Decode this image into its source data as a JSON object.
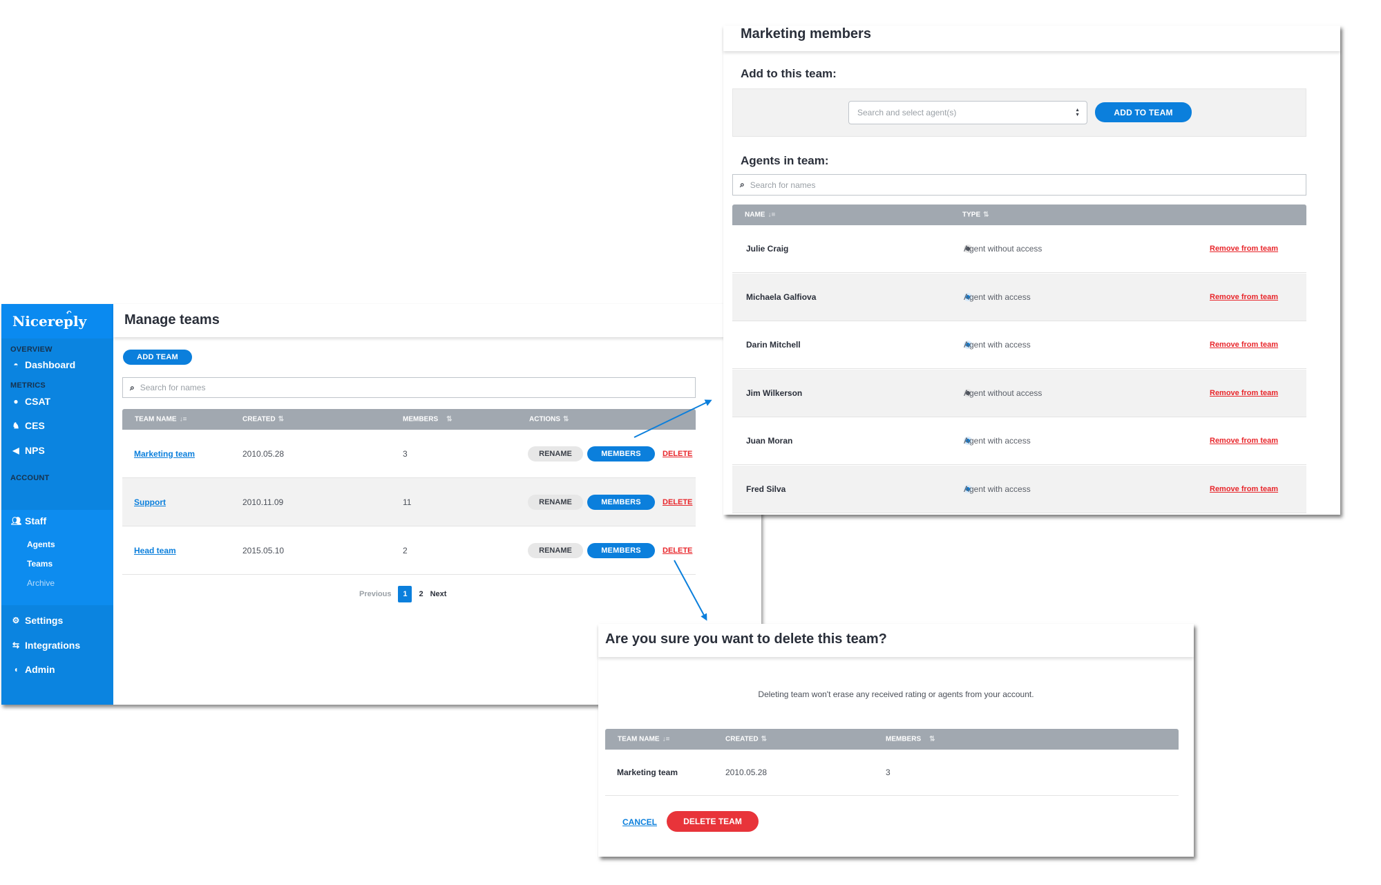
{
  "sidebar": {
    "logo": "Nicereply",
    "sections": {
      "overview": "OVERVIEW",
      "metrics": "METRICS",
      "account": "ACCOUNT"
    },
    "items": {
      "dashboard": {
        "label": "Dashboard",
        "icon": "gauge-icon"
      },
      "csat": {
        "label": "CSAT",
        "icon": "speech-bubble-icon"
      },
      "ces": {
        "label": "CES",
        "icon": "effort-icon"
      },
      "nps": {
        "label": "NPS",
        "icon": "megaphone-icon"
      },
      "staff": {
        "label": "Staff",
        "icon": "users-icon"
      },
      "settings": {
        "label": "Settings",
        "icon": "gears-icon"
      },
      "integrations": {
        "label": "Integrations",
        "icon": "arrows-exchange-icon"
      },
      "admin": {
        "label": "Admin",
        "icon": "pacman-icon"
      }
    },
    "staff_sub": {
      "agents": "Agents",
      "teams": "Teams",
      "archive": "Archive"
    }
  },
  "manage": {
    "title": "Manage teams",
    "add_team": "ADD TEAM",
    "search_placeholder": "Search for names",
    "columns": {
      "name": "TEAM NAME",
      "created": "CREATED",
      "members": "MEMBERS",
      "actions": "ACTIONS"
    },
    "rows": [
      {
        "name": "Marketing team",
        "created": "2010.05.28",
        "members": "3"
      },
      {
        "name": "Support",
        "created": "2010.11.09",
        "members": "11"
      },
      {
        "name": "Head team",
        "created": "2015.05.10",
        "members": "2"
      }
    ],
    "actions": {
      "rename": "RENAME",
      "members": "MEMBERS",
      "delete": "DELETE"
    },
    "pagination": {
      "previous": "Previous",
      "current": "1",
      "page2": "2",
      "next": "Next"
    }
  },
  "members": {
    "title": "Marketing members",
    "add_heading": "Add to this team:",
    "select_placeholder": "Search and select agent(s)",
    "add_button": "ADD TO TEAM",
    "agents_heading": "Agents in team:",
    "search_placeholder": "Search for names",
    "columns": {
      "name": "NAME",
      "type": "TYPE"
    },
    "remove_label": "Remove from team",
    "agents": [
      {
        "name": "Julie Craig",
        "type": "Agent without access",
        "access": false
      },
      {
        "name": "Michaela Galfiova",
        "type": "Agent with access",
        "access": true
      },
      {
        "name": "Darin Mitchell",
        "type": "Agent with access",
        "access": true
      },
      {
        "name": "Jim Wilkerson",
        "type": "Agent without access",
        "access": false
      },
      {
        "name": "Juan Moran",
        "type": "Agent with access",
        "access": true
      },
      {
        "name": "Fred Silva",
        "type": "Agent with access",
        "access": true
      }
    ]
  },
  "confirm": {
    "title": "Are you sure you want to delete this team?",
    "note": "Deleting team won't erase any received rating or agents from your account.",
    "columns": {
      "name": "TEAM NAME",
      "created": "CREATED",
      "members": "MEMBERS"
    },
    "row": {
      "name": "Marketing team",
      "created": "2010.05.28",
      "members": "3"
    },
    "cancel": "CANCEL",
    "delete_team": "DELETE TEAM"
  },
  "colors": {
    "brand_blue": "#0b84e0",
    "primary": "#0b7fdc",
    "danger": "#e8262b",
    "table_header": "#a1a8b0"
  }
}
